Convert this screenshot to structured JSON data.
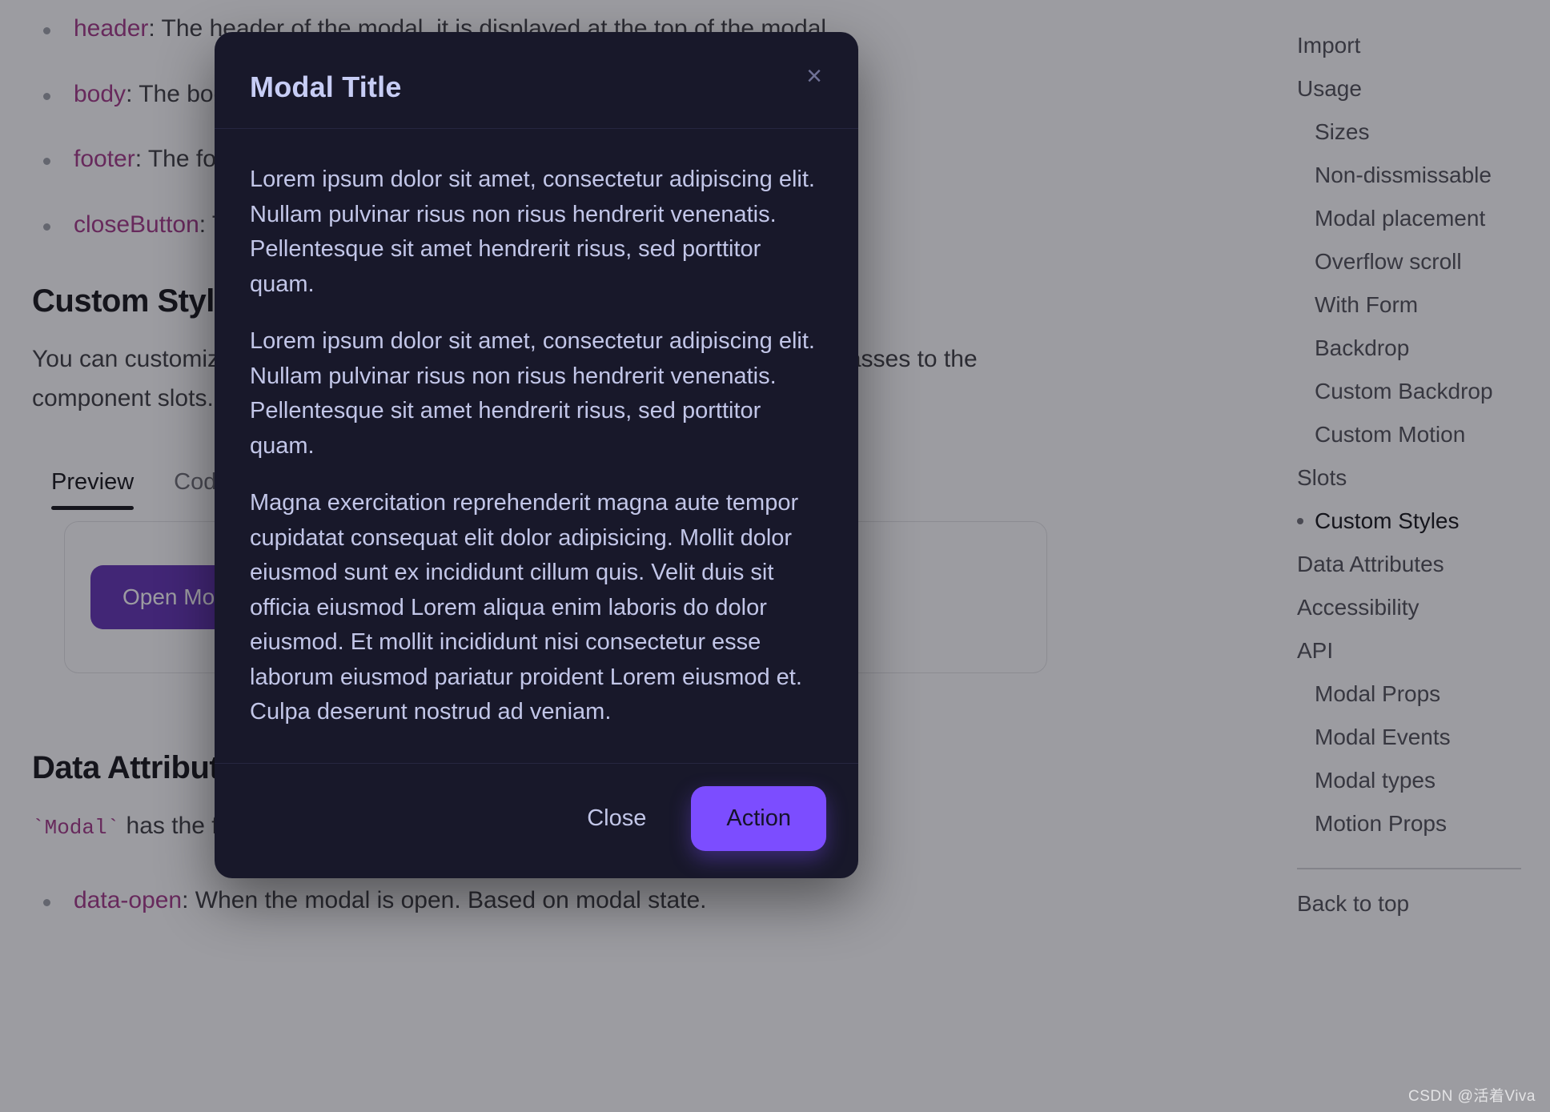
{
  "doc": {
    "slots": [
      {
        "token": "header",
        "desc": ": The header of the modal, it is displayed at the top of the modal."
      },
      {
        "token": "body",
        "desc": ": The body of the modal."
      },
      {
        "token": "footer",
        "desc": ": The footer of the modal."
      },
      {
        "token": "closeButton",
        "desc": ": The close button of the modal."
      }
    ],
    "custom_styles_heading": "Custom Styles",
    "custom_styles_paragraph": "You can customize the Modal component by passing custom Tailwind CSS classes to the component slots.",
    "tabs": [
      {
        "label": "Preview",
        "active": true
      },
      {
        "label": "Code",
        "active": false
      }
    ],
    "open_modal_label": "Open Modal",
    "data_attributes_heading": "Data Attributes",
    "data_attributes_intro_code": "`Modal`",
    "data_attributes_intro_rest": " has the following attributes on the base element:",
    "data_attributes_items": [
      {
        "token": "data-open",
        "desc": ": When the modal is open. Based on modal state."
      }
    ]
  },
  "toc": {
    "items": [
      {
        "label": "Import",
        "level": 2,
        "active": false
      },
      {
        "label": "Usage",
        "level": 2,
        "active": false
      },
      {
        "label": "Sizes",
        "level": 3,
        "active": false
      },
      {
        "label": "Non-dissmissable",
        "level": 3,
        "active": false
      },
      {
        "label": "Modal placement",
        "level": 3,
        "active": false
      },
      {
        "label": "Overflow scroll",
        "level": 3,
        "active": false
      },
      {
        "label": "With Form",
        "level": 3,
        "active": false
      },
      {
        "label": "Backdrop",
        "level": 3,
        "active": false
      },
      {
        "label": "Custom Backdrop",
        "level": 3,
        "active": false
      },
      {
        "label": "Custom Motion",
        "level": 3,
        "active": false
      },
      {
        "label": "Slots",
        "level": 2,
        "active": false
      },
      {
        "label": "Custom Styles",
        "level": 2,
        "active": true
      },
      {
        "label": "Data Attributes",
        "level": 2,
        "active": false
      },
      {
        "label": "Accessibility",
        "level": 2,
        "active": false
      },
      {
        "label": "API",
        "level": 2,
        "active": false
      },
      {
        "label": "Modal Props",
        "level": 3,
        "active": false
      },
      {
        "label": "Modal Events",
        "level": 3,
        "active": false
      },
      {
        "label": "Modal types",
        "level": 3,
        "active": false
      },
      {
        "label": "Motion Props",
        "level": 3,
        "active": false
      }
    ],
    "back_to_top": "Back to top"
  },
  "modal": {
    "title": "Modal Title",
    "close_icon": "close-icon",
    "close_icon_glyph": "×",
    "paragraphs": [
      "Lorem ipsum dolor sit amet, consectetur adipiscing elit. Nullam pulvinar risus non risus hendrerit venenatis. Pellentesque sit amet hendrerit risus, sed porttitor quam.",
      "Lorem ipsum dolor sit amet, consectetur adipiscing elit. Nullam pulvinar risus non risus hendrerit venenatis. Pellentesque sit amet hendrerit risus, sed porttitor quam.",
      "Magna exercitation reprehenderit magna aute tempor cupidatat consequat elit dolor adipisicing. Mollit dolor eiusmod sunt ex incididunt cillum quis. Velit duis sit officia eiusmod Lorem aliqua enim laboris do dolor eiusmod. Et mollit incididunt nisi consectetur esse laborum eiusmod pariatur proident Lorem eiusmod et. Culpa deserunt nostrud ad veniam."
    ],
    "footer": {
      "close_label": "Close",
      "action_label": "Action"
    },
    "colors": {
      "surface": "#18182a",
      "title": "#c7cdf5",
      "body_text": "#c2c6e8",
      "action_bg": "#7c4dff",
      "divider": "#262640"
    }
  },
  "watermark": "CSDN @活着Viva"
}
